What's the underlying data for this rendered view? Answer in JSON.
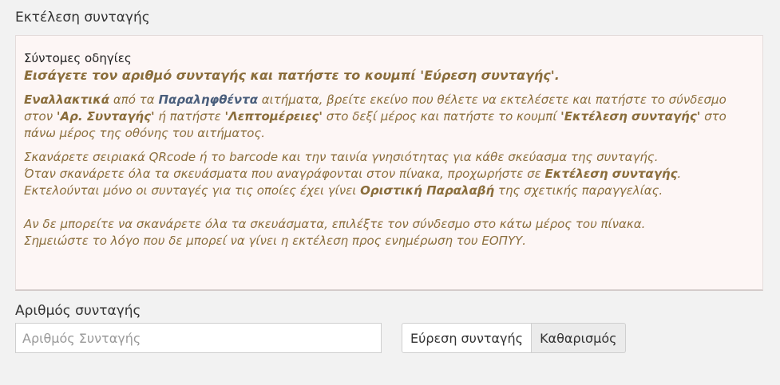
{
  "section_title": "Εκτέλεση συνταγής",
  "instructions": {
    "heading": "Σύντομες οδηγίες",
    "lead": "Εισάγετε τον αριθμό συνταγής και πατήστε το κουμπί 'Εύρεση συνταγής'.",
    "p2": {
      "t1": "Εναλλακτικά",
      "t2": " από τα ",
      "t3": "Παραληφθέντα",
      "t4": " αιτήματα, βρείτε εκείνο που θέλετε να εκτελέσετε και πατήστε το σύνδεσμο στον ",
      "t5": "'Αρ. Συνταγής'",
      "t6": " ή πατήστε ",
      "t7": "'Λεπτομέρειες'",
      "t8": " στο δεξί μέρος και πατήστε το κουμπί ",
      "t9": "'Εκτέλεση συνταγής'",
      "t10": " στο πάνω μέρος της οθόνης του αιτήματος."
    },
    "p3": {
      "t1": "Σκανάρετε σειριακά QRcode ή το barcode και την ταινία γνησιότητας για κάθε σκεύασμα της συνταγής.",
      "t2": "Όταν σκανάρετε όλα τα σκευάσματα που αναγράφονται στον πίνακα, προχωρήστε σε ",
      "t3": "Εκτέλεση συνταγής",
      "t4": ".",
      "t5": "Εκτελούνται μόνο οι συνταγές για τις οποίες έχει γίνει ",
      "t6": "Οριστική Παραλαβή",
      "t7": " της σχετικής παραγγελίας."
    },
    "p4": {
      "t1": "Αν δε μπορείτε να σκανάρετε όλα τα σκευάσματα, επιλέξτε τον σύνδεσμο στο κάτω μέρος του πίνακα.",
      "t2": "Σημειώστε το λόγο που δε μπορεί να γίνει η εκτέλεση προς ενημέρωση του ΕΟΠΥΥ."
    }
  },
  "form": {
    "label": "Αριθμός συνταγής",
    "input_placeholder": "Αριθμός Συνταγής",
    "input_value": "",
    "find_button": "Εύρεση συνταγής",
    "clear_button": "Καθαρισμός"
  }
}
